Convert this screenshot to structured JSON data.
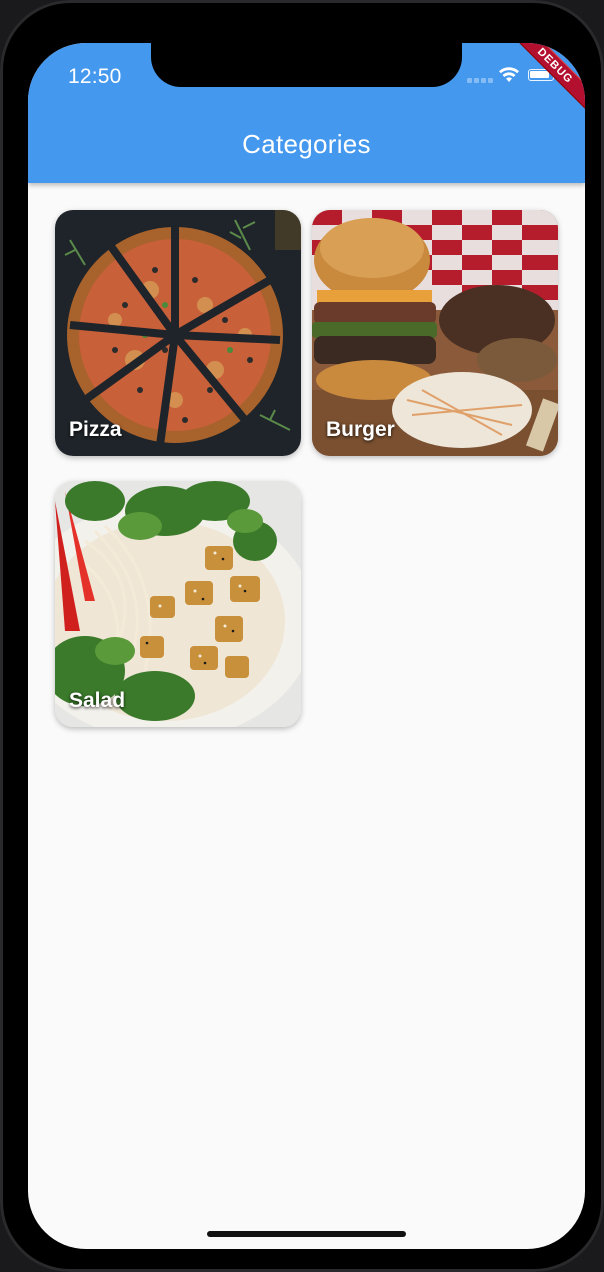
{
  "status_bar": {
    "time": "12:50"
  },
  "app_bar": {
    "title": "Categories",
    "debug_label": "DEBUG"
  },
  "categories": [
    {
      "label": "Pizza"
    },
    {
      "label": "Burger"
    },
    {
      "label": "Salad"
    }
  ],
  "colors": {
    "app_bar": "#4498ee",
    "background": "#fafafa",
    "debug_banner": "#b3102f"
  }
}
